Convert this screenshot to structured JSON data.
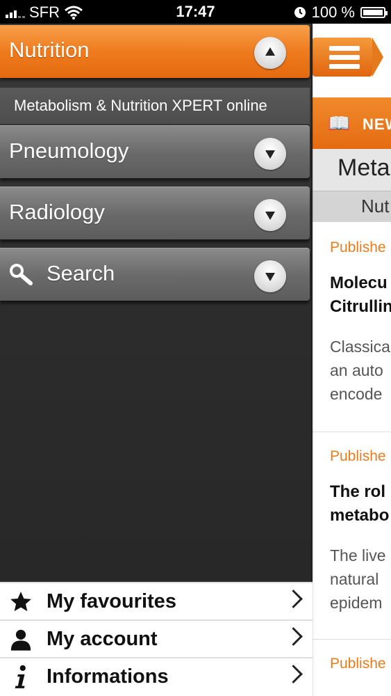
{
  "status_bar": {
    "carrier": "SFR",
    "time": "17:47",
    "battery": "100 %"
  },
  "menu": {
    "sections": [
      {
        "label": "Nutrition",
        "expanded": true,
        "toggle_icon": "chevron-up-icon"
      },
      {
        "label": "Pneumology",
        "expanded": false,
        "toggle_icon": "chevron-down-icon"
      },
      {
        "label": "Radiology",
        "expanded": false,
        "toggle_icon": "chevron-down-icon"
      },
      {
        "label": "Search",
        "expanded": false,
        "toggle_icon": "chevron-down-icon",
        "icon": "search-icon"
      }
    ],
    "subitems": [
      {
        "label": "Metabolism & Nutrition XPERT online"
      }
    ]
  },
  "bottom_menu": {
    "items": [
      {
        "label": "My favourites",
        "icon": "star-icon"
      },
      {
        "label": "My account",
        "icon": "person-icon"
      },
      {
        "label": "Informations",
        "icon": "info-icon"
      }
    ]
  },
  "content": {
    "news_label": "NEW",
    "title": "Meta",
    "subtitle": "Nut",
    "articles": [
      {
        "published": "Publishe",
        "title_lines": [
          "Molecu",
          "Citrullin"
        ],
        "excerpt_lines": [
          "Classica",
          "an auto",
          "encode"
        ]
      },
      {
        "published": "Publishe",
        "title_lines": [
          "The rol",
          "metabo"
        ],
        "excerpt_lines": [
          "The live",
          "natural",
          "epidem"
        ]
      },
      {
        "published": "Publishe",
        "title_lines": [],
        "excerpt_lines": []
      }
    ]
  },
  "colors": {
    "accent_orange": "#ee7b1e",
    "menu_gray": "#6b6b6b",
    "published_orange": "#ea7c1d"
  }
}
